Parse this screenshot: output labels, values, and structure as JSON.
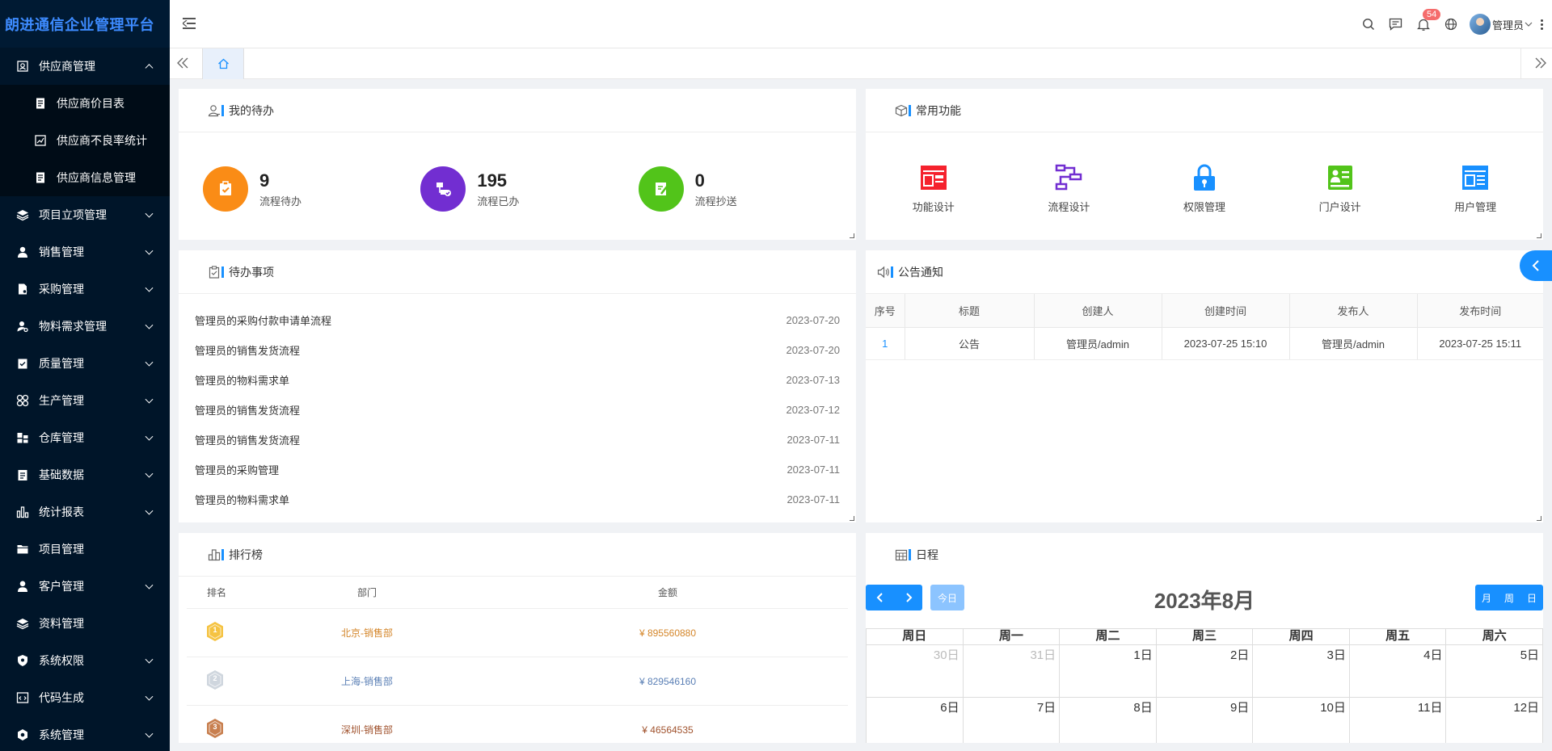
{
  "app": {
    "title": "朗进通信企业管理平台"
  },
  "header": {
    "notification_count": "54",
    "user_name": "管理员"
  },
  "sidebar": {
    "items": [
      {
        "label": "供应商管理",
        "icon": "supplier-icon",
        "expanded": true,
        "children": [
          {
            "label": "供应商价目表",
            "icon": "document-icon"
          },
          {
            "label": "供应商不良率统计",
            "icon": "chart-icon"
          },
          {
            "label": "供应商信息管理",
            "icon": "document-icon"
          }
        ]
      },
      {
        "label": "项目立项管理",
        "icon": "layers-icon",
        "has_children": true
      },
      {
        "label": "销售管理",
        "icon": "user-icon",
        "has_children": true
      },
      {
        "label": "采购管理",
        "icon": "file-icon",
        "has_children": true
      },
      {
        "label": "物料需求管理",
        "icon": "user-settings-icon",
        "has_children": true
      },
      {
        "label": "质量管理",
        "icon": "clipboard-check-icon",
        "has_children": true
      },
      {
        "label": "生产管理",
        "icon": "grid-icon",
        "has_children": true
      },
      {
        "label": "仓库管理",
        "icon": "warehouse-icon",
        "has_children": true
      },
      {
        "label": "基础数据",
        "icon": "clipboard-icon",
        "has_children": true
      },
      {
        "label": "统计报表",
        "icon": "bar-chart-icon",
        "has_children": true
      },
      {
        "label": "项目管理",
        "icon": "folder-icon",
        "has_children": false
      },
      {
        "label": "客户管理",
        "icon": "customer-icon",
        "has_children": true
      },
      {
        "label": "资料管理",
        "icon": "layers-icon",
        "has_children": false
      },
      {
        "label": "系统权限",
        "icon": "shield-icon",
        "has_children": true
      },
      {
        "label": "代码生成",
        "icon": "code-icon",
        "has_children": true
      },
      {
        "label": "系统管理",
        "icon": "gear-icon",
        "has_children": true
      }
    ]
  },
  "todo_panel": {
    "title": "我的待办",
    "stats": [
      {
        "value": "9",
        "label": "流程待办",
        "color": "#fa8c16"
      },
      {
        "value": "195",
        "label": "流程已办",
        "color": "#722ed1"
      },
      {
        "value": "0",
        "label": "流程抄送",
        "color": "#52c41a"
      }
    ]
  },
  "functions_panel": {
    "title": "常用功能",
    "items": [
      {
        "label": "功能设计",
        "color": "#f5222d"
      },
      {
        "label": "流程设计",
        "color": "#722ed1"
      },
      {
        "label": "权限管理",
        "color": "#1890ff"
      },
      {
        "label": "门户设计",
        "color": "#52c41a"
      },
      {
        "label": "用户管理",
        "color": "#1890ff"
      }
    ]
  },
  "pending_panel": {
    "title": "待办事项",
    "items": [
      {
        "text": "管理员的采购付款申请单流程",
        "date": "2023-07-20"
      },
      {
        "text": "管理员的销售发货流程",
        "date": "2023-07-20"
      },
      {
        "text": "管理员的物料需求单",
        "date": "2023-07-13"
      },
      {
        "text": "管理员的销售发货流程",
        "date": "2023-07-12"
      },
      {
        "text": "管理员的销售发货流程",
        "date": "2023-07-11"
      },
      {
        "text": "管理员的采购管理",
        "date": "2023-07-11"
      },
      {
        "text": "管理员的物料需求单",
        "date": "2023-07-11"
      }
    ]
  },
  "notice_panel": {
    "title": "公告通知",
    "columns": [
      "序号",
      "标题",
      "创建人",
      "创建时间",
      "发布人",
      "发布时间"
    ],
    "rows": [
      [
        "1",
        "公告",
        "管理员/admin",
        "2023-07-25 15:10",
        "管理员/admin",
        "2023-07-25 15:11"
      ]
    ]
  },
  "ranking_panel": {
    "title": "排行榜",
    "columns": [
      "排名",
      "部门",
      "金额"
    ],
    "rows": [
      {
        "rank": "1",
        "dept": "北京-销售部",
        "amount": "¥ 895560880",
        "color": "#d4862a",
        "medal_color": "#f5c342"
      },
      {
        "rank": "2",
        "dept": "上海-销售部",
        "amount": "¥ 829546160",
        "color": "#5a7fb5",
        "medal_color": "#cfd6de"
      },
      {
        "rank": "3",
        "dept": "深圳-销售部",
        "amount": "¥ 46564535",
        "color": "#a0522d",
        "medal_color": "#c87f4f"
      }
    ]
  },
  "schedule_panel": {
    "title": "日程",
    "month_title": "2023年8月",
    "today_label": "今日",
    "views": [
      "月",
      "周",
      "日"
    ],
    "weekdays": [
      "周日",
      "周一",
      "周二",
      "周三",
      "周四",
      "周五",
      "周六"
    ],
    "weeks": [
      [
        {
          "d": "30日",
          "other": true
        },
        {
          "d": "31日",
          "other": true
        },
        {
          "d": "1日"
        },
        {
          "d": "2日"
        },
        {
          "d": "3日"
        },
        {
          "d": "4日"
        },
        {
          "d": "5日"
        }
      ],
      [
        {
          "d": "6日"
        },
        {
          "d": "7日"
        },
        {
          "d": "8日"
        },
        {
          "d": "9日"
        },
        {
          "d": "10日"
        },
        {
          "d": "11日"
        },
        {
          "d": "12日"
        }
      ]
    ]
  }
}
